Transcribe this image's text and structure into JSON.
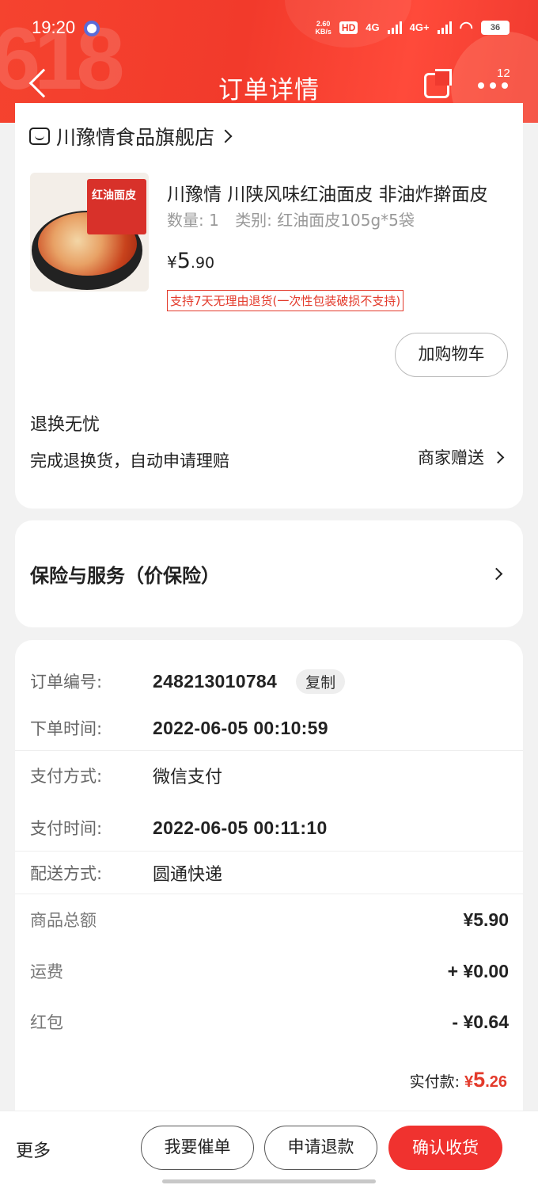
{
  "status": {
    "time": "19:20",
    "speed_value": "2.60",
    "speed_unit": "KB/s",
    "hd": "HD",
    "net1": "4G",
    "net2": "4G+",
    "battery": "36"
  },
  "nav": {
    "title": "订单详情",
    "more_badge": "12"
  },
  "store": {
    "name": "川豫情食品旗舰店"
  },
  "product": {
    "title": "川豫情 川陕风味红油面皮 非油炸擀面皮",
    "image_label": "红油面皮",
    "quantity": "数量: 1",
    "category": "类别: 红油面皮105g*5袋",
    "price_currency": "¥",
    "price_int": "5",
    "price_dec": ".90",
    "return_tag": "支持7天无理由退货(一次性包装破损不支持)",
    "cart_button": "加购物车"
  },
  "worry_free": {
    "title": "退换无忧",
    "desc": "完成退换货，自动申请理赔",
    "right": "商家赠送"
  },
  "insurance": {
    "title": "保险与服务（价保险）"
  },
  "order": {
    "number_label": "订单编号:",
    "number_value": "248213010784",
    "copy_label": "复制",
    "time_label": "下单时间:",
    "time_value": "2022-06-05 00:10:59",
    "pay_method_label": "支付方式:",
    "pay_method_value": "微信支付",
    "pay_time_label": "支付时间:",
    "pay_time_value": "2022-06-05 00:11:10",
    "delivery_label": "配送方式:",
    "delivery_value": "圆通快递"
  },
  "summary": {
    "goods_label": "商品总额",
    "goods_value": "¥5.90",
    "shipping_label": "运费",
    "shipping_value": "+ ¥0.00",
    "redpacket_label": "红包",
    "redpacket_value": "- ¥0.64",
    "paid_label": "实付款:",
    "paid_currency": "¥",
    "paid_int": "5",
    "paid_dec": ".26"
  },
  "bottom": {
    "more": "更多",
    "urge": "我要催单",
    "refund": "申请退款",
    "confirm": "确认收货"
  },
  "colors": {
    "brand_red": "#f23a2b",
    "accent_red": "#e33a2b"
  }
}
